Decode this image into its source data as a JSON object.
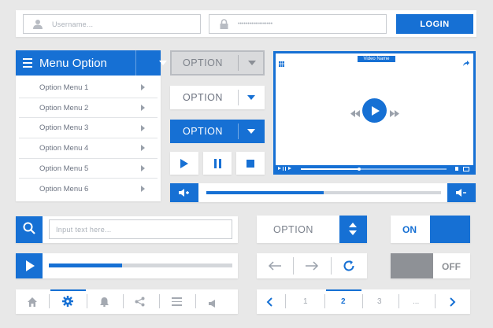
{
  "login": {
    "username_placeholder": "Username...",
    "password_placeholder": "••••••••••••••••••",
    "login_label": "LOGIN"
  },
  "menu": {
    "title": "Menu Option",
    "items": [
      {
        "label": "Option Menu 1"
      },
      {
        "label": "Option Menu 2"
      },
      {
        "label": "Option Menu 3"
      },
      {
        "label": "Option Menu 4"
      },
      {
        "label": "Option Menu 5"
      },
      {
        "label": "Option Menu 6"
      }
    ]
  },
  "dropdowns": {
    "gray_label": "OPTION",
    "white_label": "OPTION",
    "blue_label": "OPTION",
    "stepper_label": "OPTION"
  },
  "video": {
    "title": "Video Name",
    "progress": 0.4
  },
  "volume": {
    "level": 0.5
  },
  "search": {
    "placeholder": "Input text here..."
  },
  "media_progress": {
    "progress": 0.4
  },
  "toggles": {
    "on_label": "ON",
    "off_label": "OFF"
  },
  "pagination": {
    "pages": [
      "1",
      "2",
      "3",
      "..."
    ],
    "active": "2"
  },
  "colors": {
    "accent": "#1670d4",
    "panel": "#ffffff",
    "background": "#e8e8e8",
    "muted": "#9a9fa7"
  }
}
